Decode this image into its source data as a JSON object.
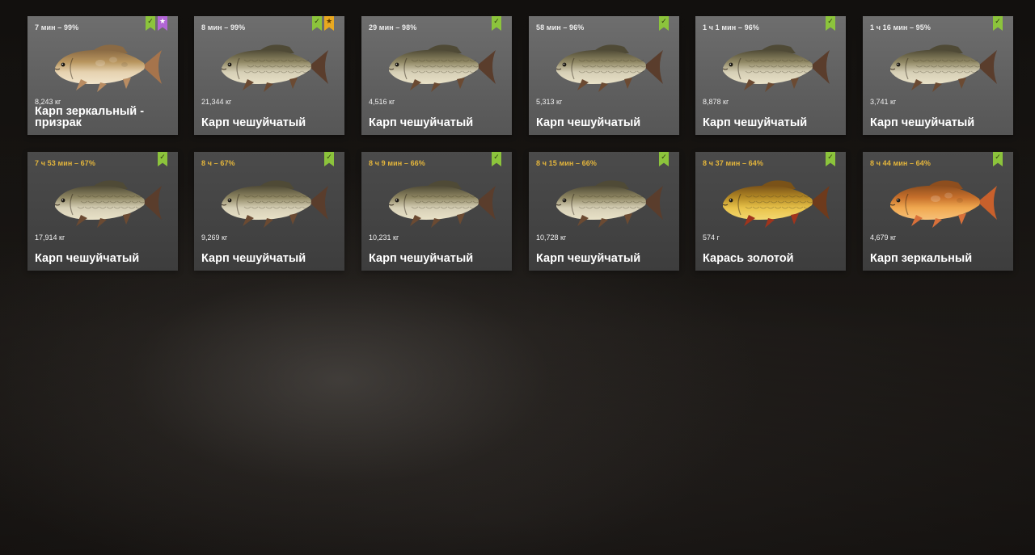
{
  "colors": {
    "check_badge": "#8cc43c",
    "ghost_badge": "#b266d6",
    "trophy_badge": "#e8a820",
    "time_highlight": "#e3b53c"
  },
  "catches": [
    {
      "time": "7 мин – 99%",
      "weight": "8,243 кг",
      "name": "Карп зеркальный - призрак",
      "fish_icon": "mirror-carp-ghost-icon",
      "badges": [
        "check",
        "purple"
      ]
    },
    {
      "time": "8 мин – 99%",
      "weight": "21,344 кг",
      "name": "Карп чешуйчатый",
      "fish_icon": "common-carp-icon",
      "badges": [
        "check",
        "gold"
      ]
    },
    {
      "time": "29 мин – 98%",
      "weight": "4,516 кг",
      "name": "Карп чешуйчатый",
      "fish_icon": "common-carp-icon",
      "badges": [
        "check"
      ]
    },
    {
      "time": "58 мин – 96%",
      "weight": "5,313 кг",
      "name": "Карп чешуйчатый",
      "fish_icon": "common-carp-icon",
      "badges": [
        "check"
      ]
    },
    {
      "time": "1 ч 1 мин – 96%",
      "weight": "8,878 кг",
      "name": "Карп чешуйчатый",
      "fish_icon": "common-carp-icon",
      "badges": [
        "check"
      ]
    },
    {
      "time": "1 ч 16 мин – 95%",
      "weight": "3,741 кг",
      "name": "Карп чешуйчатый",
      "fish_icon": "common-carp-icon",
      "badges": [
        "check"
      ]
    },
    {
      "time": "7 ч 53 мин – 67%",
      "weight": "17,914 кг",
      "name": "Карп чешуйчатый",
      "fish_icon": "common-carp-icon",
      "badges": [
        "check"
      ]
    },
    {
      "time": "8 ч – 67%",
      "weight": "9,269 кг",
      "name": "Карп чешуйчатый",
      "fish_icon": "common-carp-icon",
      "badges": [
        "check"
      ]
    },
    {
      "time": "8 ч 9 мин – 66%",
      "weight": "10,231 кг",
      "name": "Карп чешуйчатый",
      "fish_icon": "common-carp-icon",
      "badges": [
        "check"
      ]
    },
    {
      "time": "8 ч 15 мин – 66%",
      "weight": "10,728 кг",
      "name": "Карп чешуйчатый",
      "fish_icon": "common-carp-icon",
      "badges": [
        "check"
      ]
    },
    {
      "time": "8 ч 37 мин – 64%",
      "weight": "574 г",
      "name": "Карась золотой",
      "fish_icon": "goldfish-icon",
      "badges": [
        "check"
      ]
    },
    {
      "time": "8 ч 44 мин – 64%",
      "weight": "4,679 кг",
      "name": "Карп зеркальный",
      "fish_icon": "mirror-carp-icon",
      "badges": [
        "check"
      ]
    }
  ]
}
